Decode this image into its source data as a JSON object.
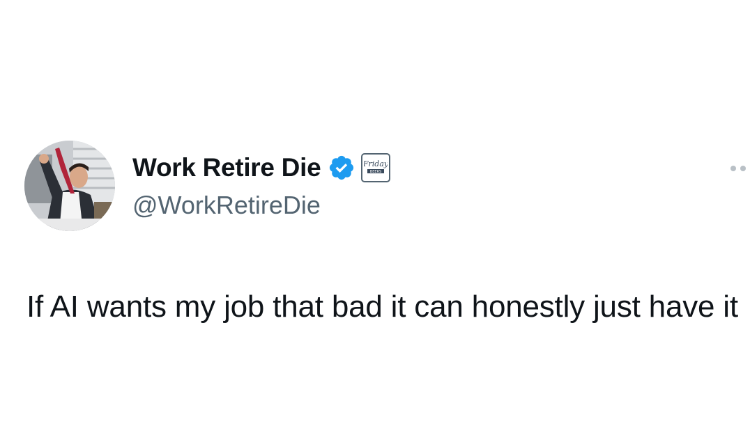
{
  "author": {
    "display_name": "Work Retire Die",
    "handle": "@WorkRetireDie",
    "verified_icon": "verified-check-icon",
    "affiliate_badge_text": "Friday Beers",
    "avatar_description_icon": "avatar"
  },
  "tweet": {
    "text": "If AI wants my job that bad it can honestly just have it"
  },
  "colors": {
    "text_primary": "#0f1419",
    "text_secondary": "#536471",
    "verified_blue": "#1d9bf0"
  }
}
